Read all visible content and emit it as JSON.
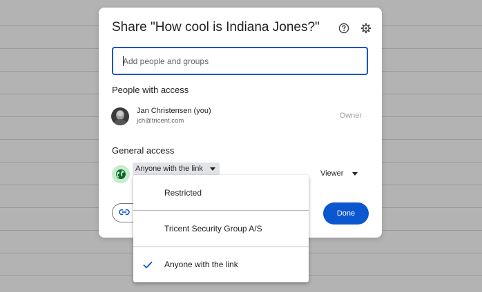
{
  "dialog": {
    "title": "Share \"How cool is Indiana Jones?\"",
    "help_icon": "help-circle-icon",
    "settings_icon": "gear-icon"
  },
  "add_people": {
    "placeholder": "Add people and groups",
    "value": ""
  },
  "people_with_access": {
    "heading": "People with access",
    "users": [
      {
        "name": "Jan Christensen (you)",
        "email": "jch@tricent.com",
        "role": "Owner"
      }
    ]
  },
  "general_access": {
    "heading": "General access",
    "selected": "Anyone with the link",
    "role": "Viewer",
    "icon": "globe-icon"
  },
  "footer": {
    "copy_link_icon": "link-icon",
    "done_label": "Done"
  },
  "access_menu": {
    "items": [
      {
        "label": "Restricted",
        "checked": false
      },
      {
        "label": "Tricent Security Group A/S",
        "checked": false
      },
      {
        "label": "Anyone with the link",
        "checked": true
      }
    ]
  },
  "colors": {
    "accent": "#0b57d0",
    "input_border": "#1a56c4",
    "globe_bg": "#c5eccb",
    "select_bg": "#e2e3e6"
  }
}
